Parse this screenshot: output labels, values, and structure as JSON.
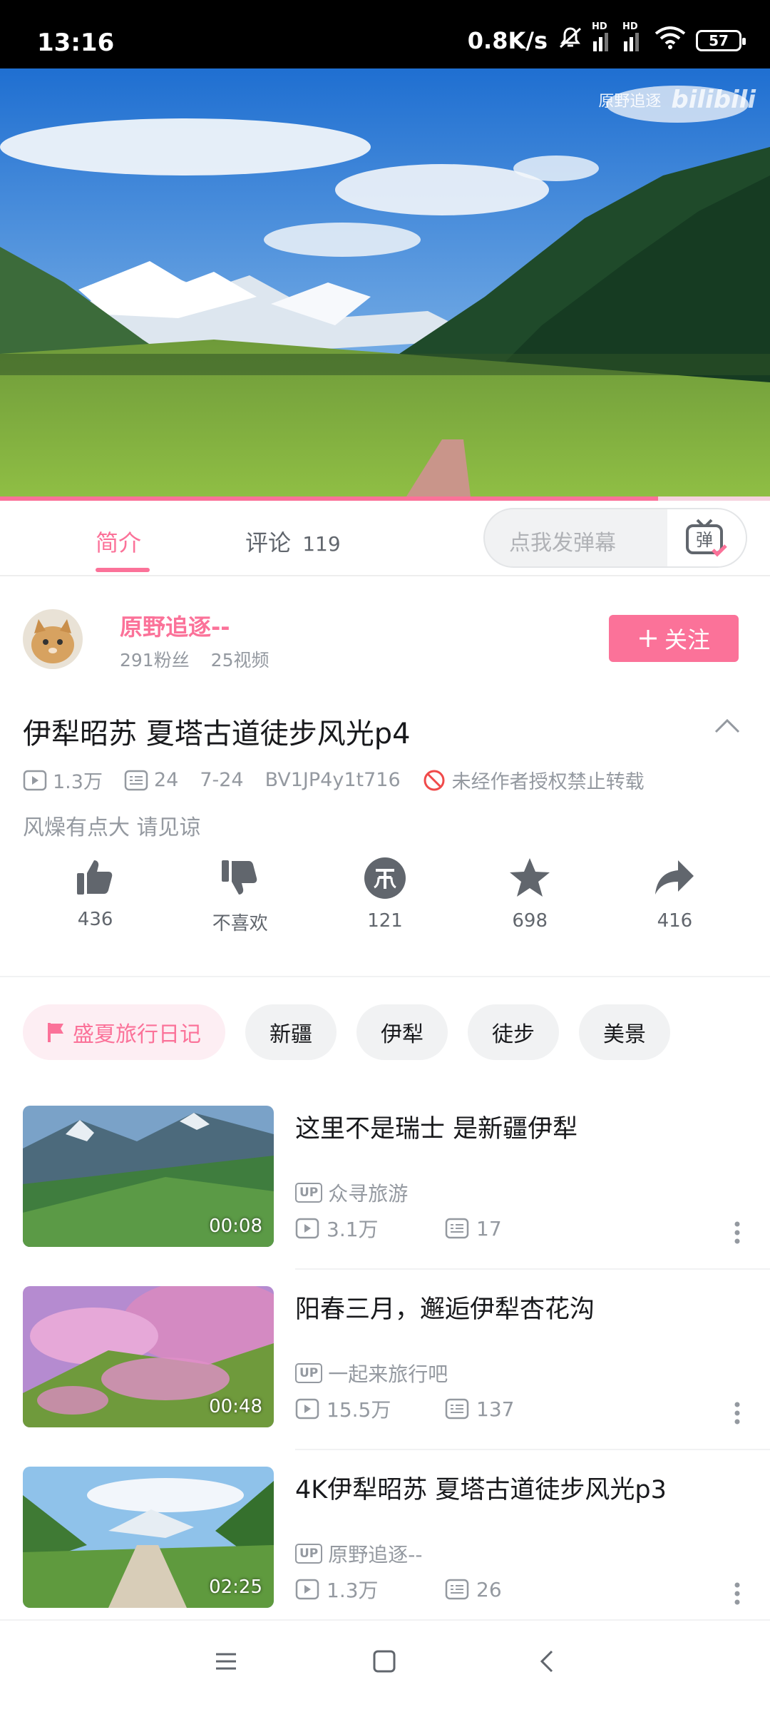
{
  "status_bar": {
    "time": "13:16",
    "speed": "0.8K/s",
    "battery": "57",
    "hd": "HD",
    "icons": [
      "mute-icon",
      "signal-icon",
      "signal-icon",
      "wifi-icon",
      "battery-icon"
    ]
  },
  "player": {
    "watermark_text": "原野追逐",
    "watermark_logo": "bilibili",
    "progress": 0.855
  },
  "tabs": {
    "intro": "简介",
    "comments_label": "评论",
    "comments_count": "119",
    "danmaku_placeholder": "点我发弹幕",
    "danmaku_icon_text": "弹"
  },
  "uploader": {
    "name": "原野追逐--",
    "fans": "291粉丝",
    "videos": "25视频",
    "follow_label": "关注"
  },
  "video": {
    "title": "伊犁昭苏 夏塔古道徒步风光p4",
    "views": "1.3万",
    "danmaku": "24",
    "date": "7-24",
    "bvid": "BV1JP4y1t716",
    "copyright": "未经作者授权禁止转载",
    "description": "风燥有点大 请见谅"
  },
  "actions": [
    {
      "name": "like",
      "icon": "thumbs-up-icon",
      "count": "436"
    },
    {
      "name": "dislike",
      "icon": "thumbs-down-icon",
      "label": "不喜欢"
    },
    {
      "name": "coin",
      "icon": "coin-icon",
      "count": "121"
    },
    {
      "name": "favorite",
      "icon": "star-icon",
      "count": "698"
    },
    {
      "name": "share",
      "icon": "share-icon",
      "count": "416"
    }
  ],
  "tags": [
    "盛夏旅行日记",
    "新疆",
    "伊犁",
    "徒步",
    "美景"
  ],
  "related": [
    {
      "title": "这里不是瑞士 是新疆伊犁",
      "uploader": "众寻旅游",
      "views": "3.1万",
      "danmaku": "17",
      "duration": "00:08"
    },
    {
      "title": "阳春三月，邂逅伊犁杏花沟",
      "uploader": "一起来旅行吧",
      "views": "15.5万",
      "danmaku": "137",
      "duration": "00:48"
    },
    {
      "title": "4K伊犁昭苏 夏塔古道徒步风光p3",
      "uploader": "原野追逐--",
      "views": "1.3万",
      "danmaku": "26",
      "duration": "02:25"
    }
  ],
  "up_badge": "UP",
  "colors": {
    "accent": "#fb7299",
    "text": "#18191c",
    "muted": "#9499a0"
  }
}
